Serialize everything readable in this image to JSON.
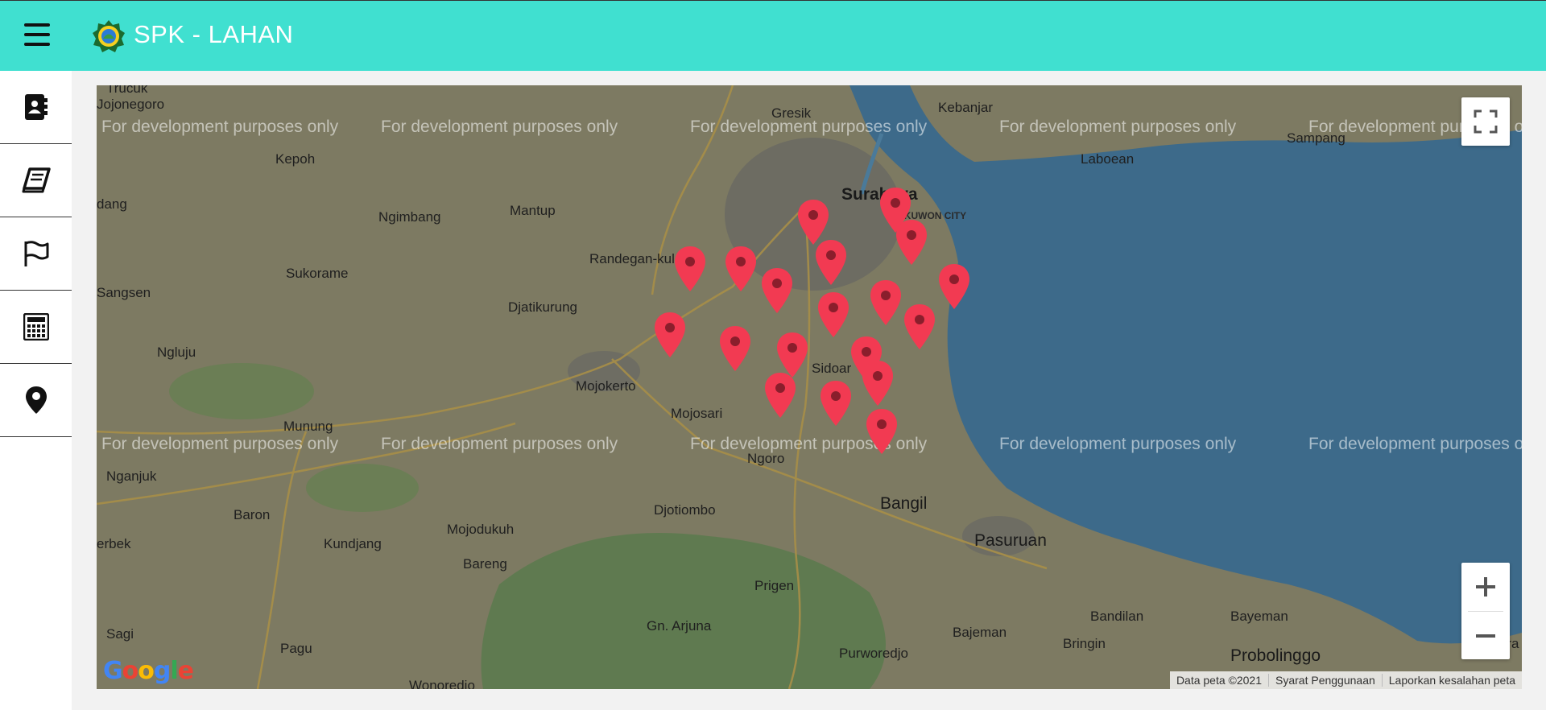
{
  "header": {
    "title": "SPK - LAHAN"
  },
  "sidebar": {
    "items": [
      {
        "icon": "address-book-icon"
      },
      {
        "icon": "book-icon"
      },
      {
        "icon": "flag-icon"
      },
      {
        "icon": "calculator-icon"
      },
      {
        "icon": "map-marker-icon"
      }
    ]
  },
  "map": {
    "watermark_text": "For development purposes only",
    "places": {
      "trucuk": "Trucuk",
      "jojonegoro": "Jojonegoro",
      "gresik": "Gresik",
      "kebanjar": "Kebanjar",
      "kepoh": "Kepoh",
      "dang": "dang",
      "ngimbang": "Ngimbang",
      "mantup": "Mantup",
      "surabaya": "Surabaya",
      "pakuwon": "PAKUWON CITY",
      "laboean": "Laboean",
      "sampang": "Sampang",
      "sukorame": "Sukorame",
      "randegan": "Randegan-kulan",
      "sangsen": "Sangsen",
      "djatikurung": "Djatikurung",
      "ngluju": "Ngluju",
      "mojokerto": "Mojokerto",
      "mojosari": "Mojosari",
      "sidoarjo": "Sidoar",
      "munung": "Munung",
      "ngoro": "Ngoro",
      "nganjuk": "Nganjuk",
      "baron": "Baron",
      "djotiombo": "Djotiombo",
      "bangil": "Bangil",
      "erbek": "erbek",
      "kundjang": "Kundjang",
      "mojodukuh": "Mojodukuh",
      "pasuruan": "Pasuruan",
      "bareng": "Bareng",
      "prigen": "Prigen",
      "sagi": "Sagi",
      "gn_arjuna": "Gn. Arjuna",
      "bandilan": "Bandilan",
      "bayeman": "Bayeman",
      "pagu": "Pagu",
      "bajeman": "Bajeman",
      "bringin": "Bringin",
      "probolinggo": "Probolinggo",
      "purworedjo": "Purworedjo",
      "wonoredjo": "Wonoredjo",
      "kra": "Kra"
    },
    "google_logo": "Google",
    "attribution": {
      "data": "Data peta ©2021",
      "terms": "Syarat Penggunaan",
      "report": "Laporkan kesalahan peta"
    },
    "colors": {
      "marker": "#f23a52",
      "sea": "#3d6a8a",
      "land": "#7d7a62",
      "header": "#40e0d0"
    }
  }
}
